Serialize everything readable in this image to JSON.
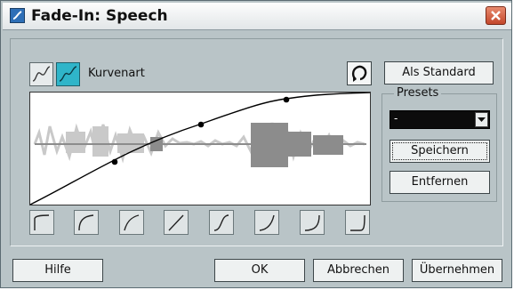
{
  "window": {
    "title": "Fade-In: Speech"
  },
  "curve": {
    "label": "Kurvenart"
  },
  "buttons": {
    "als_standard": "Als Standard",
    "speichern": "Speichern",
    "entfernen": "Entfernen",
    "hilfe": "Hilfe",
    "ok": "OK",
    "abbrechen": "Abbrechen",
    "uebernehmen": "Übernehmen"
  },
  "presets": {
    "label": "Presets",
    "selected": "-"
  },
  "icons": {
    "app": "app-icon",
    "close": "close-icon",
    "reset": "reset-curve-icon",
    "curve_type_1": "spline-curve-icon",
    "curve_type_2": "damped-spline-curve-icon",
    "shape_presets": [
      "shape-1-icon",
      "shape-2-icon",
      "shape-3-icon",
      "shape-4-icon",
      "shape-5-icon",
      "shape-6-icon",
      "shape-7-icon",
      "shape-8-icon"
    ]
  },
  "colors": {
    "window_bg": "#b9c4c7",
    "active_toggle": "#2fb5c9",
    "waveform_light": "#c9c9c9",
    "waveform_dark": "#8c8c8c",
    "close_button": "#c3472b"
  }
}
